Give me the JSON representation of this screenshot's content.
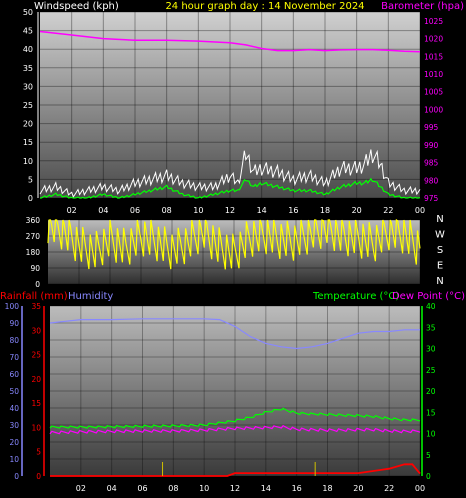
{
  "header": {
    "left_label": "Windspeed (kph)",
    "title": "24 hour graph day : 14 November 2024",
    "right_label": "Barometer (hpa)"
  },
  "colors": {
    "background": "#000000",
    "wind": "#ffffff",
    "gust": "#ffffff",
    "wind_avg": "#00ff00",
    "barometer": "#ff00ff",
    "direction": "#ffff00",
    "humidity": "#8888ff",
    "temperature": "#00ff00",
    "dewpoint": "#ff00ff",
    "rainfall": "#ff0000",
    "title": "#ffff00",
    "axis_text": "#ffffff"
  },
  "chart_data": [
    {
      "type": "line",
      "id": "wind-baro",
      "x_ticks": [
        "02",
        "04",
        "06",
        "08",
        "10",
        "12",
        "14",
        "16",
        "18",
        "20",
        "22",
        "00"
      ],
      "y_left_ticks": [
        0,
        5,
        10,
        15,
        20,
        25,
        30,
        35,
        40,
        45,
        50
      ],
      "y_left_range": [
        0,
        50
      ],
      "y_right_ticks": [
        975,
        980,
        985,
        990,
        995,
        1000,
        1005,
        1010,
        1015,
        1020,
        1025
      ],
      "y_right_range": [
        975,
        1027.5
      ],
      "series": [
        {
          "key": "barometer",
          "axis": "right",
          "hours": [
            0,
            2,
            4,
            6,
            8,
            10,
            12,
            13,
            14,
            15,
            16,
            17,
            18,
            19,
            20,
            21,
            22,
            23,
            24
          ],
          "values": [
            1022,
            1021,
            1020,
            1019.5,
            1019.5,
            1019.3,
            1018.8,
            1018.2,
            1017.2,
            1016.6,
            1016.6,
            1016.9,
            1016.6,
            1016.8,
            1016.9,
            1016.9,
            1016.7,
            1016.4,
            1016.3
          ]
        },
        {
          "key": "wind_gust",
          "axis": "left",
          "hours": [
            0,
            1,
            2,
            3,
            4,
            5,
            6,
            7,
            8,
            9,
            10,
            11,
            12,
            12.5,
            13,
            13.5,
            14,
            15,
            16,
            17,
            18,
            19,
            20,
            20.5,
            21,
            21.5,
            22,
            23,
            24
          ],
          "values": [
            2,
            3,
            1,
            2,
            3,
            2,
            4,
            5,
            6,
            4,
            3,
            3,
            6,
            4,
            12,
            7,
            8,
            7,
            5,
            6,
            4,
            8,
            8,
            9,
            12,
            9,
            4,
            2,
            2
          ]
        },
        {
          "key": "wind_avg",
          "axis": "left",
          "hours": [
            0,
            1,
            2,
            3,
            4,
            5,
            6,
            7,
            8,
            9,
            10,
            11,
            12,
            12.5,
            13,
            13.5,
            14,
            15,
            16,
            17,
            18,
            19,
            20,
            20.5,
            21,
            21.5,
            22,
            23,
            24
          ],
          "values": [
            0,
            1,
            0,
            0,
            1,
            0,
            1,
            2,
            3,
            1,
            0,
            1,
            2,
            2,
            5,
            3,
            4,
            3,
            2,
            2,
            1,
            3,
            4,
            4,
            5,
            3,
            1,
            0,
            0
          ]
        }
      ]
    },
    {
      "type": "line",
      "id": "direction",
      "x_range": [
        0,
        24
      ],
      "y_ticks": [
        0,
        90,
        180,
        270,
        360
      ],
      "y_tick_labels": [
        "0",
        "90",
        "180",
        "270",
        "360"
      ],
      "right_labels": [
        "N",
        "W",
        "S",
        "E",
        "N"
      ],
      "series": [
        {
          "key": "direction",
          "hours": [
            0,
            1,
            2,
            3,
            4,
            5,
            6,
            7,
            8,
            9,
            10,
            11,
            12,
            13,
            14,
            15,
            16,
            17,
            18,
            19,
            20,
            21,
            22,
            23,
            24
          ],
          "values": [
            340,
            300,
            220,
            180,
            250,
            200,
            270,
            240,
            190,
            230,
            300,
            210,
            170,
            260,
            280,
            250,
            240,
            290,
            320,
            270,
            260,
            230,
            300,
            280,
            200
          ]
        }
      ]
    },
    {
      "type": "line",
      "id": "temp-hum-rain",
      "header_left_rain": "Rainfall (mm)",
      "header_left_hum": "Humidity",
      "header_right_temp": "Temperature (°C)",
      "header_right_dew": "Dew Point (°C)",
      "x_ticks": [
        "02",
        "04",
        "06",
        "08",
        "10",
        "12",
        "14",
        "16",
        "18",
        "20",
        "22",
        "00"
      ],
      "y_hum_ticks": [
        0,
        10,
        20,
        30,
        40,
        50,
        60,
        70,
        80,
        90,
        100
      ],
      "y_rain_ticks": [
        0,
        5,
        10,
        15,
        20,
        25,
        30,
        35
      ],
      "y_temp_ticks": [
        0,
        5,
        10,
        15,
        20,
        25,
        30,
        35,
        40
      ],
      "y_temp_range": [
        0,
        40
      ],
      "series": [
        {
          "key": "humidity",
          "hours": [
            0,
            1,
            2,
            4,
            6,
            8,
            10,
            11,
            12,
            13,
            14,
            15,
            16,
            17,
            18,
            19,
            20,
            21,
            22,
            23,
            24
          ],
          "values": [
            90,
            91,
            92,
            92,
            92.5,
            92.5,
            92.5,
            92,
            88,
            82,
            78,
            76,
            75,
            76,
            78,
            81,
            84,
            85,
            85,
            86,
            86
          ]
        },
        {
          "key": "temperature",
          "hours": [
            0,
            2,
            4,
            6,
            8,
            10,
            11,
            12,
            13,
            14,
            15,
            16,
            17,
            18,
            19,
            20,
            21,
            22,
            23,
            24
          ],
          "values": [
            11.5,
            11.5,
            11.6,
            11.7,
            11.8,
            12.0,
            12.5,
            13.0,
            13.8,
            15.0,
            15.8,
            14.8,
            14.6,
            14.5,
            14.3,
            14.2,
            14.0,
            13.5,
            13.2,
            13.2
          ]
        },
        {
          "key": "dewpoint",
          "hours": [
            0,
            2,
            4,
            6,
            8,
            10,
            11,
            12,
            13,
            14,
            15,
            16,
            17,
            18,
            19,
            20,
            21,
            22,
            23,
            24
          ],
          "values": [
            10.2,
            10.4,
            10.5,
            10.6,
            10.6,
            10.8,
            11,
            11.2,
            11.3,
            11.4,
            11.6,
            11,
            10.9,
            10.8,
            10.8,
            10.9,
            10.9,
            10.6,
            10.5,
            10.6
          ]
        },
        {
          "key": "rainfall",
          "hours": [
            0,
            2,
            4,
            6,
            8,
            10,
            11,
            11.5,
            12,
            14,
            16,
            18,
            20,
            22,
            23,
            23.5,
            24
          ],
          "values": [
            0,
            0,
            0,
            0,
            0,
            0,
            0,
            0,
            0.6,
            0.6,
            0.6,
            0.6,
            0.6,
            1.5,
            2.4,
            2.4,
            0.5
          ]
        }
      ]
    }
  ]
}
